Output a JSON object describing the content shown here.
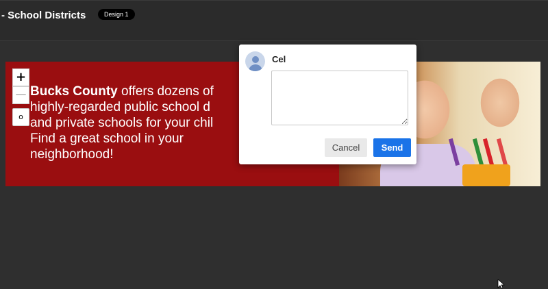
{
  "header": {
    "title": "- School Districts",
    "badge": "Design 1"
  },
  "banner": {
    "bold_text": "Bucks County",
    "line1_rest": " offers dozens of",
    "line2": "highly-regarded public school d",
    "line3": "and private schools for your chil",
    "line4": "Find a great school in your",
    "line5": "neighborhood!"
  },
  "zoom": {
    "in_label": "+",
    "out_label": "—",
    "reset_label": "o"
  },
  "comment_popup": {
    "username": "Cel",
    "input_value": "",
    "cancel_label": "Cancel",
    "send_label": "Send"
  },
  "colors": {
    "page_background": "#2f2f2f",
    "banner_red": "#9a0e10",
    "send_blue": "#1a73e8"
  },
  "icons": [
    "user-avatar-icon",
    "mouse-cursor-icon"
  ]
}
